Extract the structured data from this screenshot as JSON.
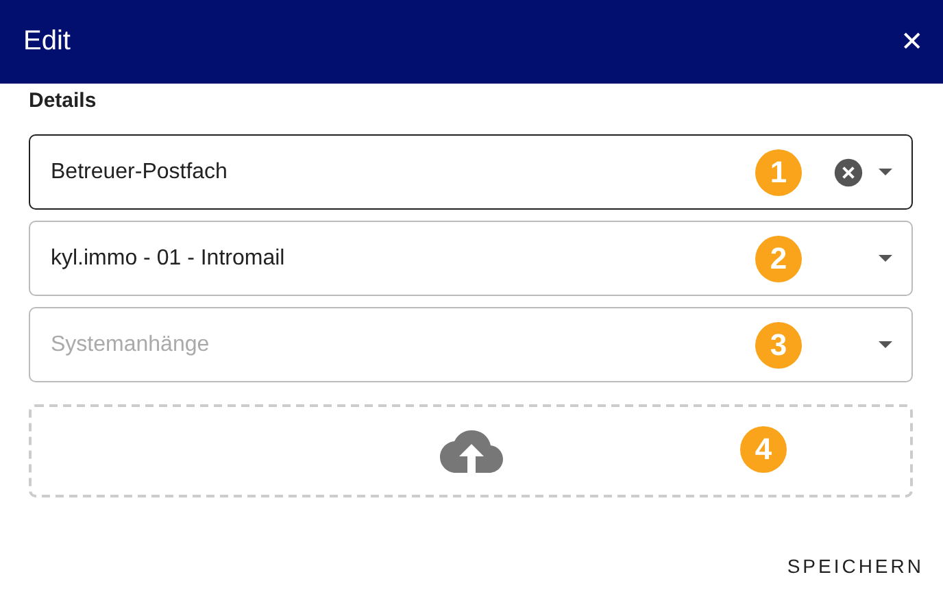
{
  "window": {
    "title": "Edit",
    "close": "✕"
  },
  "section": {
    "label": "Details"
  },
  "fields": [
    {
      "value": "Betreuer-Postfach",
      "badge": "1",
      "focused": true,
      "clearable": true
    },
    {
      "value": "kyl.immo - 01 - Intromail",
      "badge": "2",
      "focused": false,
      "clearable": false
    },
    {
      "placeholder": "Systemanhänge",
      "badge": "3",
      "focused": false,
      "clearable": false
    }
  ],
  "upload": {
    "badge": "4"
  },
  "buttons": [
    {
      "label": "SPEICHERN"
    }
  ]
}
